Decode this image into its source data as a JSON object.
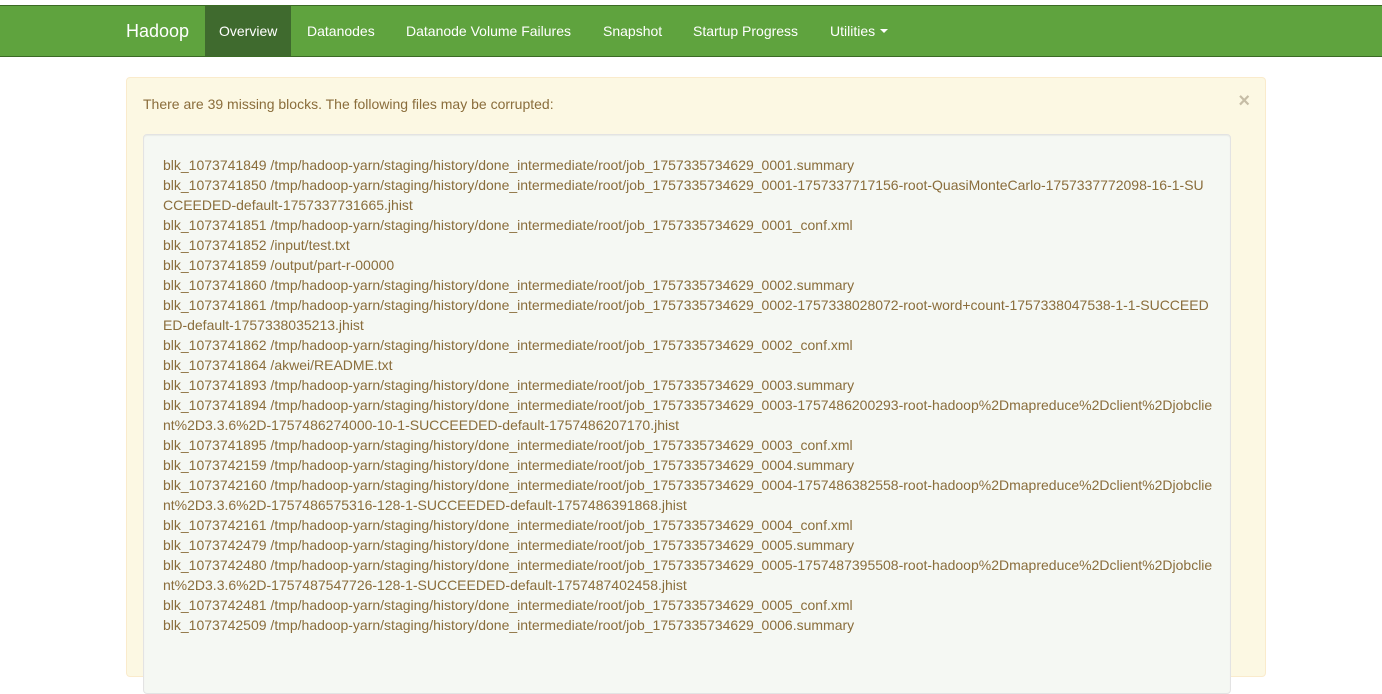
{
  "navbar": {
    "brand": "Hadoop",
    "items": [
      {
        "label": "Overview",
        "active": true
      },
      {
        "label": "Datanodes",
        "active": false
      },
      {
        "label": "Datanode Volume Failures",
        "active": false
      },
      {
        "label": "Snapshot",
        "active": false
      },
      {
        "label": "Startup Progress",
        "active": false
      },
      {
        "label": "Utilities",
        "active": false
      }
    ],
    "background_color": "#5fa33e",
    "active_color": "#3f6a2e"
  },
  "alert": {
    "message": "There are 39 missing blocks. The following files may be corrupted:",
    "close_glyph": "×",
    "background_color": "#fcf8e3",
    "text_color": "#8a6d3b"
  },
  "missing_files": [
    "blk_1073741849 /tmp/hadoop-yarn/staging/history/done_intermediate/root/job_1757335734629_0001.summary",
    "blk_1073741850 /tmp/hadoop-yarn/staging/history/done_intermediate/root/job_1757335734629_0001-1757337717156-root-QuasiMonteCarlo-1757337772098-16-1-SUCCEEDED-default-1757337731665.jhist",
    "blk_1073741851 /tmp/hadoop-yarn/staging/history/done_intermediate/root/job_1757335734629_0001_conf.xml",
    "blk_1073741852 /input/test.txt",
    "blk_1073741859 /output/part-r-00000",
    "blk_1073741860 /tmp/hadoop-yarn/staging/history/done_intermediate/root/job_1757335734629_0002.summary",
    "blk_1073741861 /tmp/hadoop-yarn/staging/history/done_intermediate/root/job_1757335734629_0002-1757338028072-root-word+count-1757338047538-1-1-SUCCEEDED-default-1757338035213.jhist",
    "blk_1073741862 /tmp/hadoop-yarn/staging/history/done_intermediate/root/job_1757335734629_0002_conf.xml",
    "blk_1073741864 /akwei/README.txt",
    "blk_1073741893 /tmp/hadoop-yarn/staging/history/done_intermediate/root/job_1757335734629_0003.summary",
    "blk_1073741894 /tmp/hadoop-yarn/staging/history/done_intermediate/root/job_1757335734629_0003-1757486200293-root-hadoop%2Dmapreduce%2Dclient%2Djobclient%2D3.3.6%2D-1757486274000-10-1-SUCCEEDED-default-1757486207170.jhist",
    "blk_1073741895 /tmp/hadoop-yarn/staging/history/done_intermediate/root/job_1757335734629_0003_conf.xml",
    "blk_1073742159 /tmp/hadoop-yarn/staging/history/done_intermediate/root/job_1757335734629_0004.summary",
    "blk_1073742160 /tmp/hadoop-yarn/staging/history/done_intermediate/root/job_1757335734629_0004-1757486382558-root-hadoop%2Dmapreduce%2Dclient%2Djobclient%2D3.3.6%2D-1757486575316-128-1-SUCCEEDED-default-1757486391868.jhist",
    "blk_1073742161 /tmp/hadoop-yarn/staging/history/done_intermediate/root/job_1757335734629_0004_conf.xml",
    "blk_1073742479 /tmp/hadoop-yarn/staging/history/done_intermediate/root/job_1757335734629_0005.summary",
    "blk_1073742480 /tmp/hadoop-yarn/staging/history/done_intermediate/root/job_1757335734629_0005-1757487395508-root-hadoop%2Dmapreduce%2Dclient%2Djobclient%2D3.3.6%2D-1757487547726-128-1-SUCCEEDED-default-1757487402458.jhist",
    "blk_1073742481 /tmp/hadoop-yarn/staging/history/done_intermediate/root/job_1757335734629_0005_conf.xml",
    "blk_1073742509 /tmp/hadoop-yarn/staging/history/done_intermediate/root/job_1757335734629_0006.summary"
  ]
}
